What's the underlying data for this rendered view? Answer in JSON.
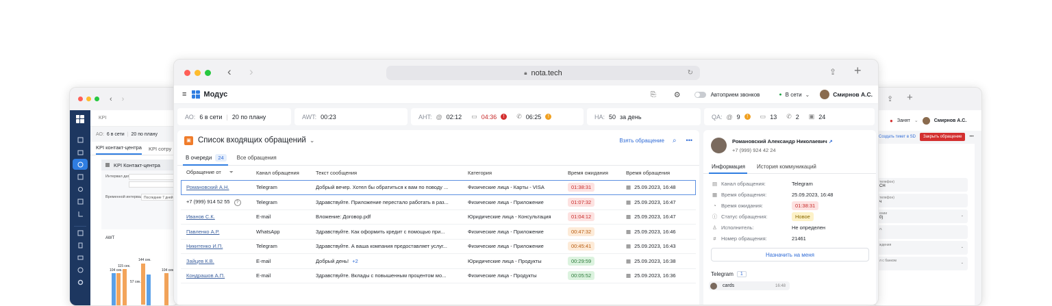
{
  "left_window": {
    "section": "KPI",
    "ao_label": "АО:",
    "ao_online": "6 в сети",
    "ao_plan": "20 по плану",
    "tab_active": "KPI контакт-центра",
    "tab_other": "KPI сотру",
    "panel_title": "KPI Контакт-центра",
    "interval_label": "Интервал дат",
    "time_interval_label": "Временной интервал",
    "time_interval_value": "Последние 7 дней",
    "chart_title": "AWT",
    "chart_labels": [
      "104 сек.",
      "115 сек.",
      "144 сек.",
      "57 сек.",
      "104 сек."
    ]
  },
  "right_window": {
    "status": "Занят",
    "user": "Смирнов А.С.",
    "create_ticket": "Создать тикет в SD",
    "close_request": "Закрыть обращение",
    "fields": [
      "телефон)",
      "СН",
      "телефон)",
      "ч",
      "ении",
      "0)",
      "л.",
      "ждения",
      "л с банком"
    ]
  },
  "browser": {
    "url": "nota.tech"
  },
  "appbar": {
    "brand": "Модус",
    "auto_accept": "Автоприем звонков",
    "status": "В сети",
    "user": "Смирнов А.С."
  },
  "kpi": {
    "ao_label": "АО:",
    "ao_online": "6 в сети",
    "ao_plan": "20 по плану",
    "awt_label": "AWT:",
    "awt_value": "00:23",
    "aht_label": "AHT:",
    "aht_email": "02:12",
    "aht_chat": "04:36",
    "aht_phone": "06:25",
    "na_label": "НА:",
    "na_value": "50",
    "na_suffix": "за день",
    "qa_label": "QA:",
    "qa_email": "9",
    "qa_chat": "13",
    "qa_phone": "2",
    "qa_other": "24"
  },
  "requests": {
    "title": "Список входящих обращений",
    "take_button": "Взять обращение",
    "tab_queue": "В очереди",
    "tab_queue_count": "24",
    "tab_all": "Все обращения",
    "columns": [
      "Обращение от",
      "Канал обращения",
      "Текст сообщения",
      "Категория",
      "Время ожидания",
      "Время обращения"
    ],
    "rows": [
      {
        "from": "Романовский А.Н.",
        "channel": "Telegram",
        "text": "Добрый вечер. Хотел бы обратиться к вам по поводу ...",
        "category": "Физические лица - Карты - VISA",
        "wait": "01:38:31",
        "level": "red",
        "time": "25.09.2023, 16:48"
      },
      {
        "from": "+7 (999) 914 52 55",
        "channel": "Telegram",
        "text": "Здравствуйте. Приложение перестало работать в раз...",
        "category": "Физические лица - Приложение",
        "wait": "01:07:32",
        "level": "red",
        "time": "25.09.2023, 16:47"
      },
      {
        "from": "Иванов С.К.",
        "channel": "E-mail",
        "text": "Вложение: Договор.pdf",
        "category": "Юридические лица - Консультация",
        "wait": "01:04:12",
        "level": "red",
        "time": "25.09.2023, 16:47"
      },
      {
        "from": "Павленко А.Р.",
        "channel": "WhatsApp",
        "text": "Здравствуйте. Как оформить кредит с помощью при...",
        "category": "Физические лица - Приложение",
        "wait": "00:47:32",
        "level": "orange",
        "time": "25.09.2023, 16:46"
      },
      {
        "from": "Никитенко И.П.",
        "channel": "Telegram",
        "text": "Здравствуйте. А ваша компания предоставляет услуг...",
        "category": "Физические лица - Приложение",
        "wait": "00:45:41",
        "level": "orange",
        "time": "25.09.2023, 16:43"
      },
      {
        "from": "Зайцев К.В.",
        "channel": "E-mail",
        "text": "Добрый день!",
        "extra": "+2",
        "category": "Юридические лица - Продукты",
        "wait": "00:29:59",
        "level": "green",
        "time": "25.09.2023, 16:38"
      },
      {
        "from": "Кондрашов А.П.",
        "channel": "E-mail",
        "text": "Здравствуйте. Вклады с повышенным процентом мо...",
        "category": "Физические лица - Продукты",
        "wait": "00:05:52",
        "level": "green",
        "time": "25.09.2023, 16:36"
      }
    ]
  },
  "detail": {
    "name": "Романовский Александр Николаевич",
    "phone": "+7 (999) 924 42 24",
    "tab_info": "Информация",
    "tab_history": "История коммуникаций",
    "fields": [
      {
        "label": "Канал обращения:",
        "value": "Telegram",
        "icon": "channel-icon"
      },
      {
        "label": "Время обращения:",
        "value": "25.09.2023, 16:48",
        "icon": "calendar-icon"
      },
      {
        "label": "Время ожидания:",
        "value": "01:38:31",
        "icon": "clock-icon",
        "badge": "red"
      },
      {
        "label": "Статус обращения:",
        "value": "Новое",
        "icon": "status-icon",
        "badge": "yellow"
      },
      {
        "label": "Исполнитель:",
        "value": "Не определен",
        "icon": "person-icon"
      },
      {
        "label": "Номер обращения:",
        "value": "21461",
        "icon": "hash-icon"
      }
    ],
    "assign_button": "Назначить на меня",
    "telegram_label": "Telegram",
    "telegram_count": "1",
    "message_preview": "cards",
    "message_time": "16:48"
  }
}
